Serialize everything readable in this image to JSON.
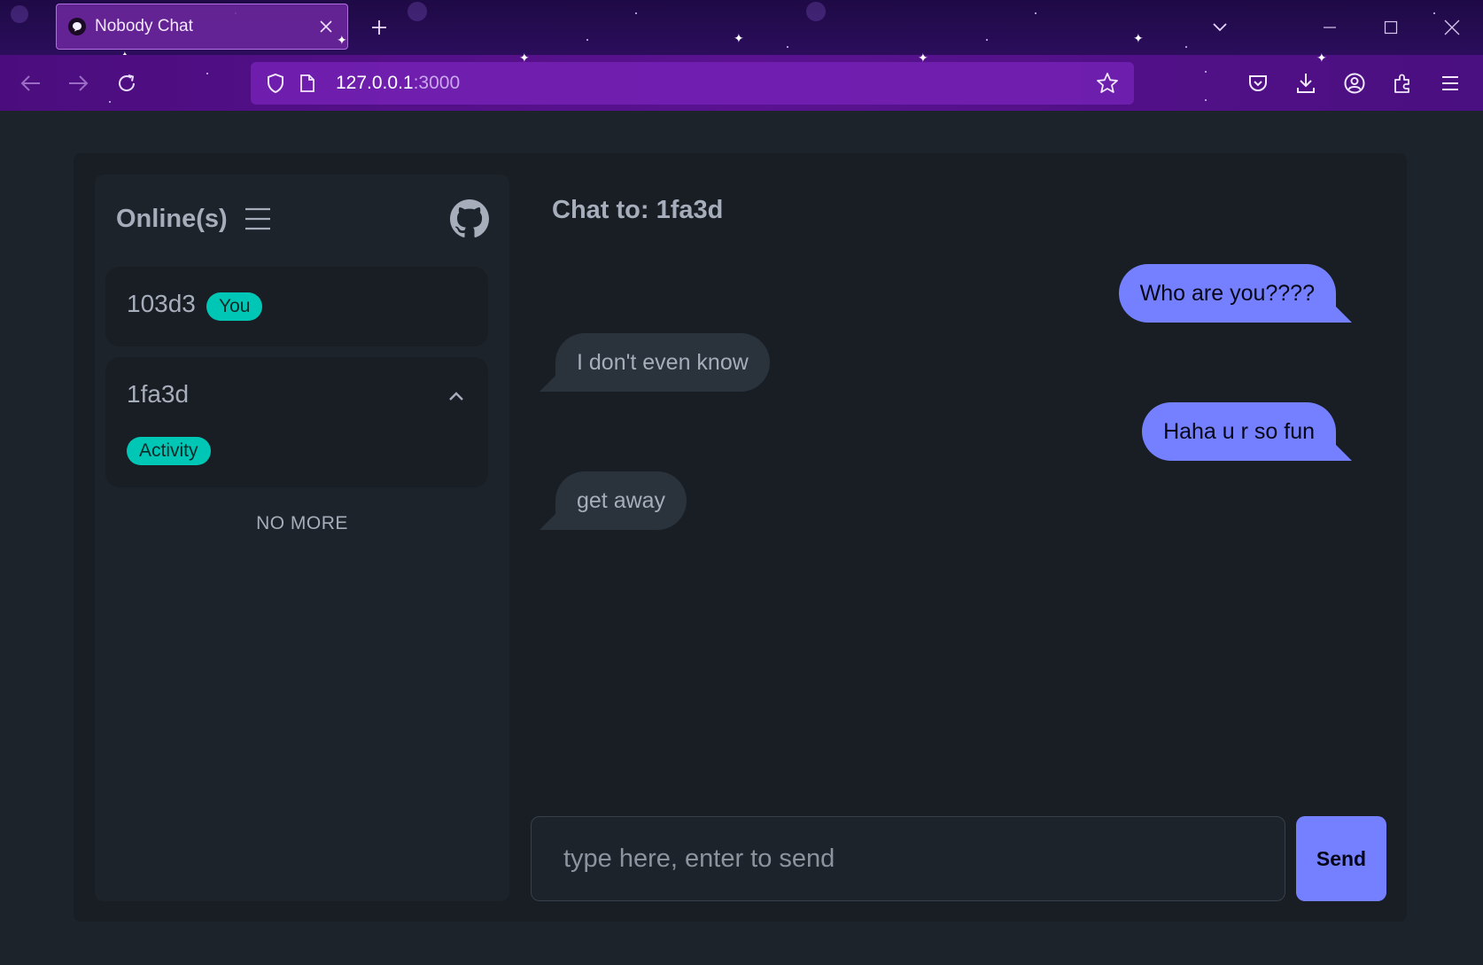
{
  "browser": {
    "tab_title": "Nobody Chat",
    "url_host": "127.0.0.1",
    "url_port": ":3000",
    "icons": {
      "back": "arrow-left-icon",
      "forward": "arrow-right-icon",
      "reload": "reload-icon",
      "shield": "tracking-protection-icon",
      "page": "page-icon",
      "bookmark": "star-icon",
      "pocket": "pocket-icon",
      "downloads": "download-icon",
      "account": "account-icon",
      "extensions": "puzzle-icon",
      "menu": "hamburger-menu-icon"
    },
    "theme": {
      "accent": "#4a1180",
      "tab": "#6e28a0"
    }
  },
  "sidebar": {
    "title": "Online(s)",
    "users": [
      {
        "name": "103d3",
        "badge": "You"
      },
      {
        "name": "1fa3d",
        "badge": "Activity",
        "expanded": true
      }
    ],
    "end_text": "NO MORE"
  },
  "chat": {
    "title": "Chat to: 1fa3d",
    "messages": [
      {
        "direction": "out",
        "text": "Who are you????"
      },
      {
        "direction": "in",
        "text": "I don't even know"
      },
      {
        "direction": "out",
        "text": "Haha u r so fun"
      },
      {
        "direction": "in",
        "text": "get away"
      }
    ],
    "input_placeholder": "type here, enter to send",
    "input_value": "",
    "send_label": "Send"
  },
  "colors": {
    "primary": "#7480ff",
    "badge": "#00c7b5",
    "base": "#1d232a",
    "text": "#a6adbb"
  }
}
